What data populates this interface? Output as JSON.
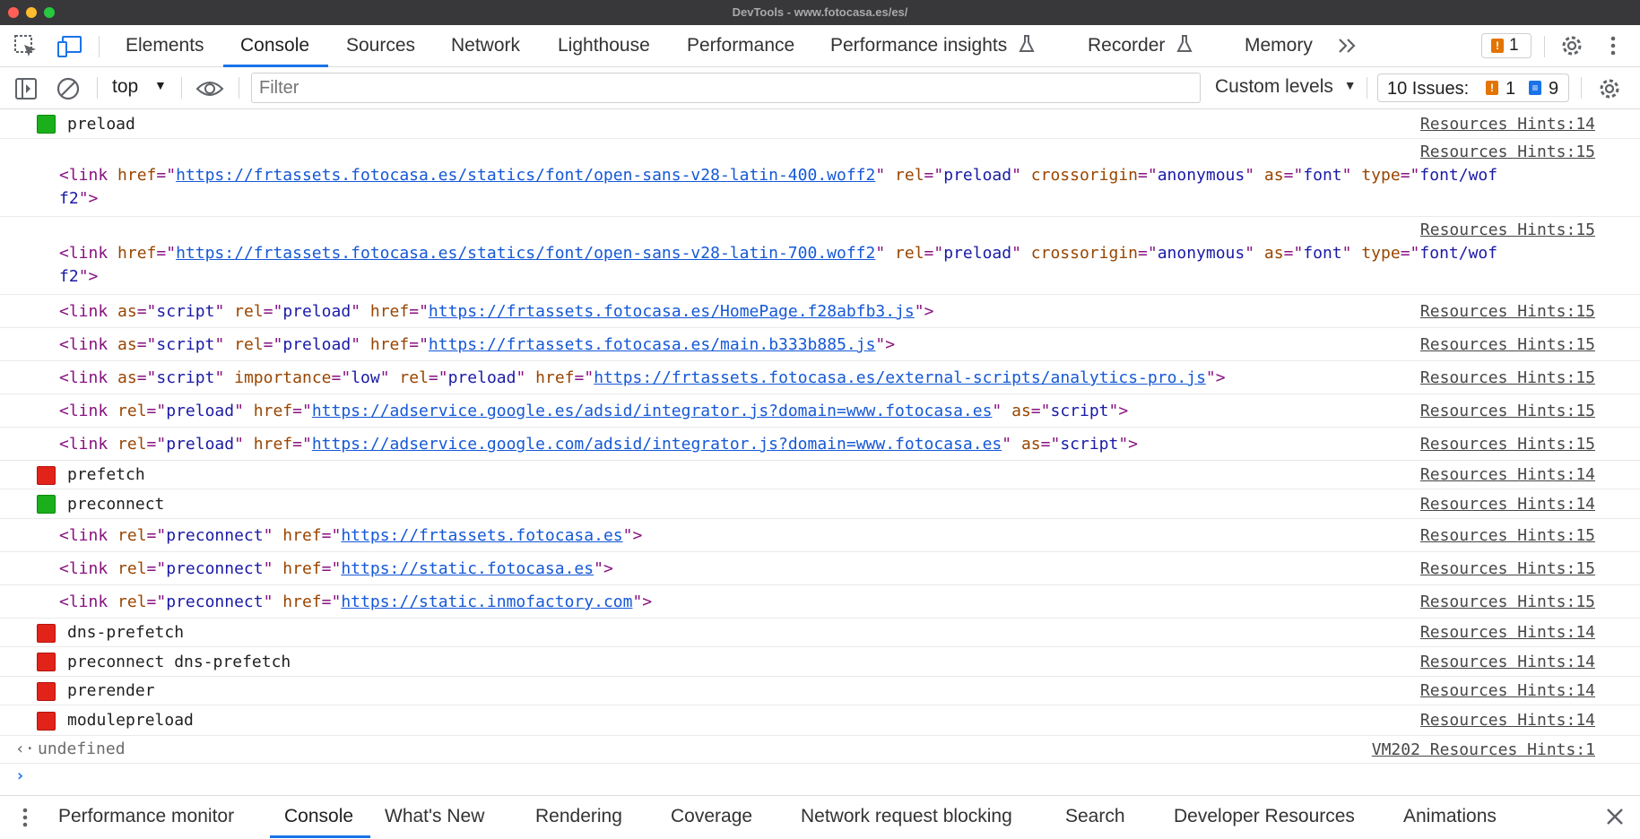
{
  "window": {
    "title": "DevTools - www.fotocasa.es/es/"
  },
  "tabs": [
    "Elements",
    "Console",
    "Sources",
    "Network",
    "Lighthouse",
    "Performance",
    "Performance insights",
    "Recorder",
    "Memory"
  ],
  "top_issue_count": "1",
  "toolbar": {
    "context": "top",
    "filter_placeholder": "Filter",
    "levels": "Custom levels",
    "issues_label": "10 Issues:",
    "issues_warn": "1",
    "issues_info": "9"
  },
  "colors": {
    "accent": "#1a73e8",
    "green": "#1bb01b",
    "red": "#e2231a",
    "tag": "#881280",
    "attr_name": "#994500",
    "attr_value": "#1a1aa6",
    "link": "#1558d6"
  },
  "messages": [
    {
      "kind": "group",
      "color": "green",
      "text": "preload",
      "source": "Resources Hints:14"
    },
    {
      "kind": "tag",
      "source": "Resources Hints:15",
      "line1": [
        [
          "t",
          "<link "
        ],
        [
          "n",
          "href"
        ],
        [
          "t",
          "=\""
        ],
        [
          "l",
          "https://frtassets.fotocasa.es/statics/font/open-sans-v28-latin-400.woff2"
        ],
        [
          "t",
          "\" "
        ],
        [
          "n",
          "rel"
        ],
        [
          "t",
          "=\""
        ],
        [
          "v",
          "preload"
        ],
        [
          "t",
          "\" "
        ],
        [
          "n",
          "crossorigin"
        ],
        [
          "t",
          "=\""
        ],
        [
          "v",
          "anonymous"
        ],
        [
          "t",
          "\" "
        ],
        [
          "n",
          "as"
        ],
        [
          "t",
          "=\""
        ],
        [
          "v",
          "font"
        ],
        [
          "t",
          "\" "
        ],
        [
          "n",
          "type"
        ],
        [
          "t",
          "=\""
        ],
        [
          "v",
          "font/wof"
        ]
      ],
      "line2": [
        [
          "v",
          "f2"
        ],
        [
          "t",
          "\">"
        ]
      ]
    },
    {
      "kind": "tag",
      "source": "Resources Hints:15",
      "line1": [
        [
          "t",
          "<link "
        ],
        [
          "n",
          "href"
        ],
        [
          "t",
          "=\""
        ],
        [
          "l",
          "https://frtassets.fotocasa.es/statics/font/open-sans-v28-latin-700.woff2"
        ],
        [
          "t",
          "\" "
        ],
        [
          "n",
          "rel"
        ],
        [
          "t",
          "=\""
        ],
        [
          "v",
          "preload"
        ],
        [
          "t",
          "\" "
        ],
        [
          "n",
          "crossorigin"
        ],
        [
          "t",
          "=\""
        ],
        [
          "v",
          "anonymous"
        ],
        [
          "t",
          "\" "
        ],
        [
          "n",
          "as"
        ],
        [
          "t",
          "=\""
        ],
        [
          "v",
          "font"
        ],
        [
          "t",
          "\" "
        ],
        [
          "n",
          "type"
        ],
        [
          "t",
          "=\""
        ],
        [
          "v",
          "font/wof"
        ]
      ],
      "line2": [
        [
          "v",
          "f2"
        ],
        [
          "t",
          "\">"
        ]
      ]
    },
    {
      "kind": "tag",
      "source": "Resources Hints:15",
      "line1": [
        [
          "t",
          "<link "
        ],
        [
          "n",
          "as"
        ],
        [
          "t",
          "=\""
        ],
        [
          "v",
          "script"
        ],
        [
          "t",
          "\" "
        ],
        [
          "n",
          "rel"
        ],
        [
          "t",
          "=\""
        ],
        [
          "v",
          "preload"
        ],
        [
          "t",
          "\" "
        ],
        [
          "n",
          "href"
        ],
        [
          "t",
          "=\""
        ],
        [
          "l",
          "https://frtassets.fotocasa.es/HomePage.f28abfb3.js"
        ],
        [
          "t",
          "\">"
        ]
      ]
    },
    {
      "kind": "tag",
      "source": "Resources Hints:15",
      "line1": [
        [
          "t",
          "<link "
        ],
        [
          "n",
          "as"
        ],
        [
          "t",
          "=\""
        ],
        [
          "v",
          "script"
        ],
        [
          "t",
          "\" "
        ],
        [
          "n",
          "rel"
        ],
        [
          "t",
          "=\""
        ],
        [
          "v",
          "preload"
        ],
        [
          "t",
          "\" "
        ],
        [
          "n",
          "href"
        ],
        [
          "t",
          "=\""
        ],
        [
          "l",
          "https://frtassets.fotocasa.es/main.b333b885.js"
        ],
        [
          "t",
          "\">"
        ]
      ]
    },
    {
      "kind": "tag",
      "source": "Resources Hints:15",
      "line1": [
        [
          "t",
          "<link "
        ],
        [
          "n",
          "as"
        ],
        [
          "t",
          "=\""
        ],
        [
          "v",
          "script"
        ],
        [
          "t",
          "\" "
        ],
        [
          "n",
          "importance"
        ],
        [
          "t",
          "=\""
        ],
        [
          "v",
          "low"
        ],
        [
          "t",
          "\" "
        ],
        [
          "n",
          "rel"
        ],
        [
          "t",
          "=\""
        ],
        [
          "v",
          "preload"
        ],
        [
          "t",
          "\" "
        ],
        [
          "n",
          "href"
        ],
        [
          "t",
          "=\""
        ],
        [
          "l",
          "https://frtassets.fotocasa.es/external-scripts/analytics-pro.js"
        ],
        [
          "t",
          "\">"
        ]
      ]
    },
    {
      "kind": "tag",
      "source": "Resources Hints:15",
      "line1": [
        [
          "t",
          "<link "
        ],
        [
          "n",
          "rel"
        ],
        [
          "t",
          "=\""
        ],
        [
          "v",
          "preload"
        ],
        [
          "t",
          "\" "
        ],
        [
          "n",
          "href"
        ],
        [
          "t",
          "=\""
        ],
        [
          "l",
          "https://adservice.google.es/adsid/integrator.js?domain=www.fotocasa.es"
        ],
        [
          "t",
          "\" "
        ],
        [
          "n",
          "as"
        ],
        [
          "t",
          "=\""
        ],
        [
          "v",
          "script"
        ],
        [
          "t",
          "\">"
        ]
      ]
    },
    {
      "kind": "tag",
      "source": "Resources Hints:15",
      "line1": [
        [
          "t",
          "<link "
        ],
        [
          "n",
          "rel"
        ],
        [
          "t",
          "=\""
        ],
        [
          "v",
          "preload"
        ],
        [
          "t",
          "\" "
        ],
        [
          "n",
          "href"
        ],
        [
          "t",
          "=\""
        ],
        [
          "l",
          "https://adservice.google.com/adsid/integrator.js?domain=www.fotocasa.es"
        ],
        [
          "t",
          "\" "
        ],
        [
          "n",
          "as"
        ],
        [
          "t",
          "=\""
        ],
        [
          "v",
          "script"
        ],
        [
          "t",
          "\">"
        ]
      ]
    },
    {
      "kind": "group",
      "color": "red",
      "text": "prefetch",
      "source": "Resources Hints:14"
    },
    {
      "kind": "group",
      "color": "green",
      "text": "preconnect",
      "source": "Resources Hints:14"
    },
    {
      "kind": "tag",
      "source": "Resources Hints:15",
      "line1": [
        [
          "t",
          "<link "
        ],
        [
          "n",
          "rel"
        ],
        [
          "t",
          "=\""
        ],
        [
          "v",
          "preconnect"
        ],
        [
          "t",
          "\" "
        ],
        [
          "n",
          "href"
        ],
        [
          "t",
          "=\""
        ],
        [
          "l",
          "https://frtassets.fotocasa.es"
        ],
        [
          "t",
          "\">"
        ]
      ]
    },
    {
      "kind": "tag",
      "source": "Resources Hints:15",
      "line1": [
        [
          "t",
          "<link "
        ],
        [
          "n",
          "rel"
        ],
        [
          "t",
          "=\""
        ],
        [
          "v",
          "preconnect"
        ],
        [
          "t",
          "\" "
        ],
        [
          "n",
          "href"
        ],
        [
          "t",
          "=\""
        ],
        [
          "l",
          "https://static.fotocasa.es"
        ],
        [
          "t",
          "\">"
        ]
      ]
    },
    {
      "kind": "tag",
      "source": "Resources Hints:15",
      "line1": [
        [
          "t",
          "<link "
        ],
        [
          "n",
          "rel"
        ],
        [
          "t",
          "=\""
        ],
        [
          "v",
          "preconnect"
        ],
        [
          "t",
          "\" "
        ],
        [
          "n",
          "href"
        ],
        [
          "t",
          "=\""
        ],
        [
          "l",
          "https://static.inmofactory.com"
        ],
        [
          "t",
          "\">"
        ]
      ]
    },
    {
      "kind": "group",
      "color": "red",
      "text": "dns-prefetch",
      "source": "Resources Hints:14"
    },
    {
      "kind": "group",
      "color": "red",
      "text": "preconnect dns-prefetch",
      "source": "Resources Hints:14"
    },
    {
      "kind": "group",
      "color": "red",
      "text": "prerender",
      "source": "Resources Hints:14"
    },
    {
      "kind": "group",
      "color": "red",
      "text": "modulepreload",
      "source": "Resources Hints:14"
    },
    {
      "kind": "result",
      "text": "undefined",
      "source": "VM202 Resources Hints:1"
    }
  ],
  "drawer_tabs": [
    "Performance monitor",
    "Console",
    "What's New",
    "Rendering",
    "Coverage",
    "Network request blocking",
    "Search",
    "Developer Resources",
    "Animations"
  ]
}
